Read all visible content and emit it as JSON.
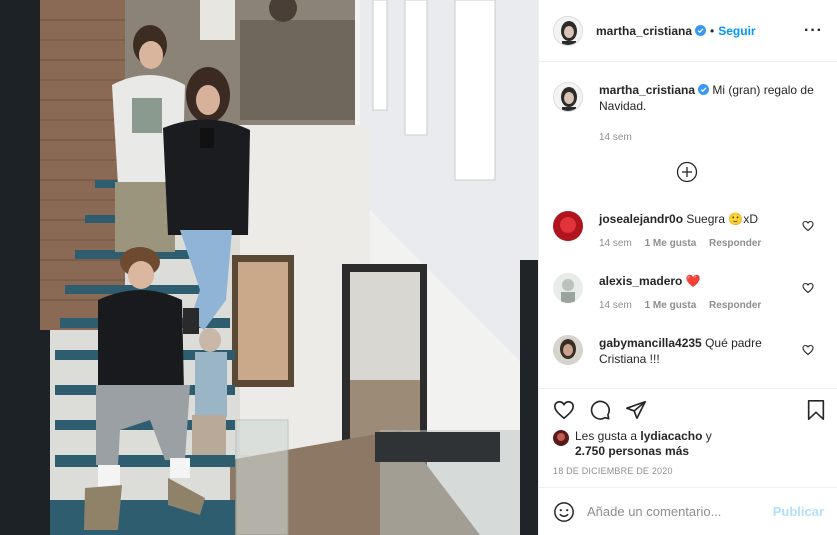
{
  "post": {
    "author": "martha_cristiana",
    "follow_label": "Seguir",
    "dot": "•",
    "more": "···"
  },
  "caption": {
    "author": "martha_cristiana",
    "text": " Mi (gran) regalo de Navidad.",
    "time": "14 sem"
  },
  "comments": [
    {
      "user": "josealejandr0o",
      "text": " Suegra 🙂xD",
      "time": "14 sem",
      "likes": "1 Me gusta",
      "reply": "Responder"
    },
    {
      "user": "alexis_madero",
      "text": " ❤️",
      "time": "14 sem",
      "likes": "1 Me gusta",
      "reply": "Responder"
    },
    {
      "user": "gabymancilla4235",
      "text": " Qué padre Cristiana !!!",
      "time": "",
      "likes": "",
      "reply": ""
    }
  ],
  "likes_line": {
    "prefix": "Les gusta a ",
    "user": "lydiacacho",
    "mid": " y",
    "count": "2.750 personas más"
  },
  "date": "18 DE DICIEMBRE DE 2020",
  "add_comment": {
    "placeholder": "Añade un comentario...",
    "publish": "Publicar"
  },
  "colors": {
    "accent": "#0095f6",
    "publish_disabled": "#b2dffc",
    "muted": "#8e8e8e",
    "heart_red": "#ed4956"
  },
  "icons": [
    "verified-badge-icon",
    "more-options-icon",
    "load-more-icon",
    "heart-icon",
    "comment-icon",
    "share-icon",
    "save-icon",
    "emoji-icon"
  ]
}
